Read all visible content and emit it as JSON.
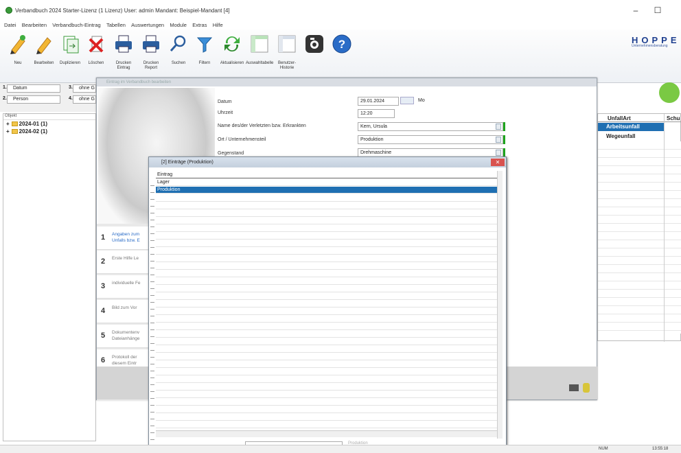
{
  "window": {
    "title": "Verbandbuch 2024 Starter-Lizenz (1 Lizenz)   User: admin Mandant: Beispiel-Mandant [4]",
    "minimize": "–",
    "maximize": "☐"
  },
  "menu": [
    "Datei",
    "Bearbeiten",
    "Verbandbuch-Eintrag",
    "Tabellen",
    "Auswertungen",
    "Module",
    "Extras",
    "Hilfe"
  ],
  "toolbar": [
    {
      "label": "Neu",
      "icon": "new-pencil-icon"
    },
    {
      "label": "Bearbeiten",
      "icon": "edit-pencil-icon"
    },
    {
      "label": "Duplizieren",
      "icon": "duplicate-icon"
    },
    {
      "label": "Löschen",
      "icon": "delete-icon"
    },
    {
      "label": "Drucken Eintrag",
      "icon": "printer-icon"
    },
    {
      "label": "Drucken Report",
      "icon": "printer-icon"
    },
    {
      "label": "Suchen",
      "icon": "search-icon"
    },
    {
      "label": "Filtern",
      "icon": "filter-icon"
    },
    {
      "label": "Aktualisieren",
      "icon": "refresh-icon"
    },
    {
      "label": "Auswahltabelle",
      "icon": "table-icon"
    },
    {
      "label": "Benutzer-Historie",
      "icon": "history-icon"
    },
    {
      "label": "",
      "icon": "camera-icon"
    },
    {
      "label": "",
      "icon": "help-icon"
    }
  ],
  "logo": {
    "text": "HOPPE",
    "subtitle": "Unternehmensberatung"
  },
  "filters": [
    {
      "num": "1.",
      "value": "Datum"
    },
    {
      "num": "2.",
      "value": "Person"
    },
    {
      "num": "3.",
      "value": "ohne G"
    },
    {
      "num": "4.",
      "value": "ohne G"
    }
  ],
  "tree": {
    "header": "Objekt",
    "nodes": [
      "2024-01  (1)",
      "2024-02  (1)"
    ]
  },
  "dialog": {
    "caption": "Eintrag im Verbandbuch bearbeiten",
    "fields": [
      {
        "label": "Datum",
        "value": "29.01.2024",
        "extra": "Mo"
      },
      {
        "label": "Uhrzeit",
        "value": "12:20"
      },
      {
        "label": "Name des/der Verletzten bzw. Erkrankten",
        "value": "Kern, Ursula"
      },
      {
        "label": "Ort / Unternehmensteil",
        "value": "Produktion"
      },
      {
        "label": "Gegenstand",
        "value": "Drehmaschine"
      }
    ],
    "steps": [
      {
        "n": "1",
        "text": "Angaben zum Unfalls bzw. E"
      },
      {
        "n": "2",
        "text": "Erste Hilfe Le"
      },
      {
        "n": "3",
        "text": "individuelle Fe"
      },
      {
        "n": "4",
        "text": "Bild zum Vor"
      },
      {
        "n": "5",
        "text": "Dokumentenv Dateianhänge"
      },
      {
        "n": "6",
        "text": "Protokoll der diesem Eintr"
      }
    ]
  },
  "right_grid": {
    "headers": [
      "UnfallArt",
      "Schu"
    ],
    "rows": [
      "Arbeitsunfall",
      "Wegeunfall"
    ]
  },
  "popup": {
    "caption": "[2] Einträge   (Produktion)",
    "close": "✕",
    "column_header": "Eintrag",
    "items": [
      "Lager",
      "Produktion"
    ],
    "selected": "Produktion",
    "footer_search_placeholder": "Produktion"
  },
  "status": {
    "num": "NUM",
    "time": "13:55:18"
  },
  "colors": {
    "selection": "#1f6fb2",
    "accent_green": "#1ea51e",
    "logo_blue": "#1e3f8f"
  }
}
